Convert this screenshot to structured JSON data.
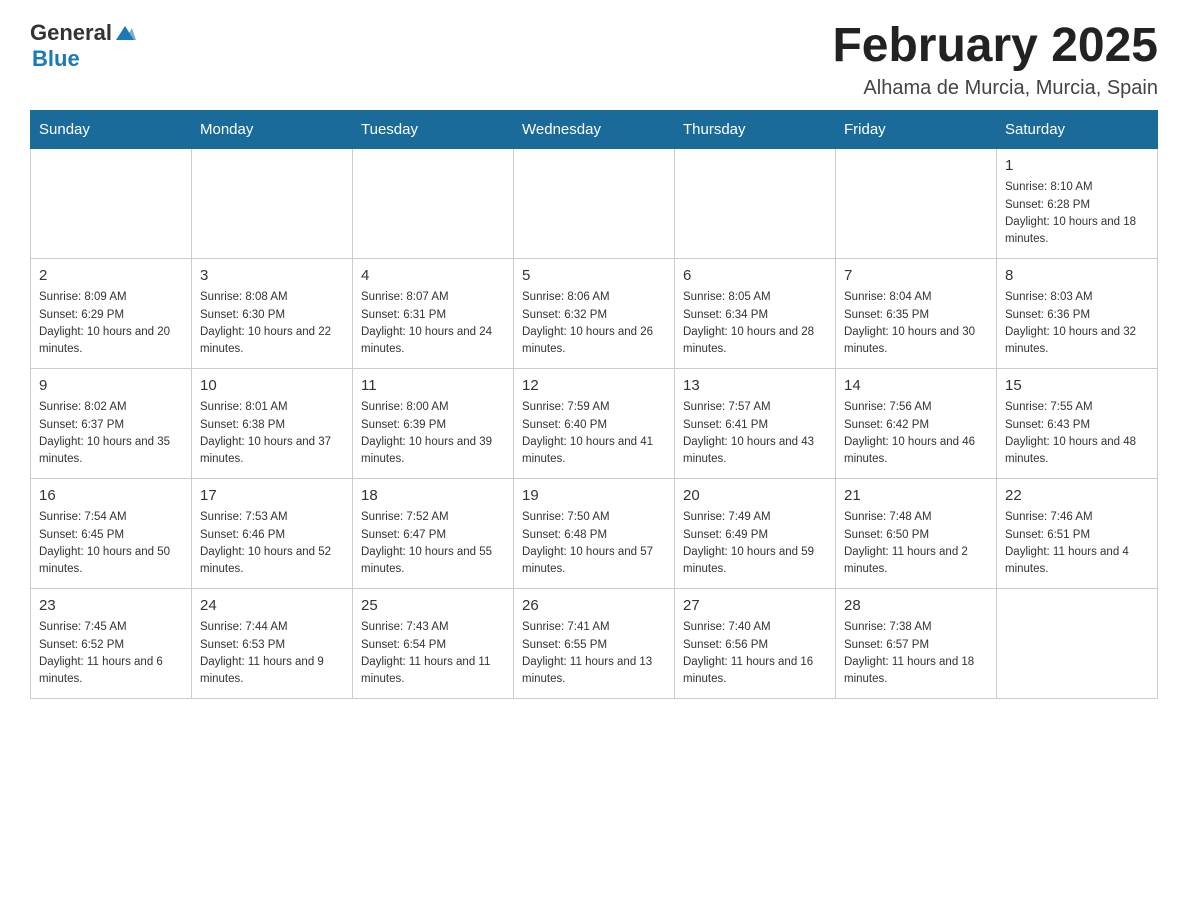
{
  "header": {
    "logo_general": "General",
    "logo_blue": "Blue",
    "month_title": "February 2025",
    "location": "Alhama de Murcia, Murcia, Spain"
  },
  "days_of_week": [
    "Sunday",
    "Monday",
    "Tuesday",
    "Wednesday",
    "Thursday",
    "Friday",
    "Saturday"
  ],
  "weeks": [
    {
      "days": [
        {
          "date": "",
          "info": ""
        },
        {
          "date": "",
          "info": ""
        },
        {
          "date": "",
          "info": ""
        },
        {
          "date": "",
          "info": ""
        },
        {
          "date": "",
          "info": ""
        },
        {
          "date": "",
          "info": ""
        },
        {
          "date": "1",
          "info": "Sunrise: 8:10 AM\nSunset: 6:28 PM\nDaylight: 10 hours and 18 minutes."
        }
      ]
    },
    {
      "days": [
        {
          "date": "2",
          "info": "Sunrise: 8:09 AM\nSunset: 6:29 PM\nDaylight: 10 hours and 20 minutes."
        },
        {
          "date": "3",
          "info": "Sunrise: 8:08 AM\nSunset: 6:30 PM\nDaylight: 10 hours and 22 minutes."
        },
        {
          "date": "4",
          "info": "Sunrise: 8:07 AM\nSunset: 6:31 PM\nDaylight: 10 hours and 24 minutes."
        },
        {
          "date": "5",
          "info": "Sunrise: 8:06 AM\nSunset: 6:32 PM\nDaylight: 10 hours and 26 minutes."
        },
        {
          "date": "6",
          "info": "Sunrise: 8:05 AM\nSunset: 6:34 PM\nDaylight: 10 hours and 28 minutes."
        },
        {
          "date": "7",
          "info": "Sunrise: 8:04 AM\nSunset: 6:35 PM\nDaylight: 10 hours and 30 minutes."
        },
        {
          "date": "8",
          "info": "Sunrise: 8:03 AM\nSunset: 6:36 PM\nDaylight: 10 hours and 32 minutes."
        }
      ]
    },
    {
      "days": [
        {
          "date": "9",
          "info": "Sunrise: 8:02 AM\nSunset: 6:37 PM\nDaylight: 10 hours and 35 minutes."
        },
        {
          "date": "10",
          "info": "Sunrise: 8:01 AM\nSunset: 6:38 PM\nDaylight: 10 hours and 37 minutes."
        },
        {
          "date": "11",
          "info": "Sunrise: 8:00 AM\nSunset: 6:39 PM\nDaylight: 10 hours and 39 minutes."
        },
        {
          "date": "12",
          "info": "Sunrise: 7:59 AM\nSunset: 6:40 PM\nDaylight: 10 hours and 41 minutes."
        },
        {
          "date": "13",
          "info": "Sunrise: 7:57 AM\nSunset: 6:41 PM\nDaylight: 10 hours and 43 minutes."
        },
        {
          "date": "14",
          "info": "Sunrise: 7:56 AM\nSunset: 6:42 PM\nDaylight: 10 hours and 46 minutes."
        },
        {
          "date": "15",
          "info": "Sunrise: 7:55 AM\nSunset: 6:43 PM\nDaylight: 10 hours and 48 minutes."
        }
      ]
    },
    {
      "days": [
        {
          "date": "16",
          "info": "Sunrise: 7:54 AM\nSunset: 6:45 PM\nDaylight: 10 hours and 50 minutes."
        },
        {
          "date": "17",
          "info": "Sunrise: 7:53 AM\nSunset: 6:46 PM\nDaylight: 10 hours and 52 minutes."
        },
        {
          "date": "18",
          "info": "Sunrise: 7:52 AM\nSunset: 6:47 PM\nDaylight: 10 hours and 55 minutes."
        },
        {
          "date": "19",
          "info": "Sunrise: 7:50 AM\nSunset: 6:48 PM\nDaylight: 10 hours and 57 minutes."
        },
        {
          "date": "20",
          "info": "Sunrise: 7:49 AM\nSunset: 6:49 PM\nDaylight: 10 hours and 59 minutes."
        },
        {
          "date": "21",
          "info": "Sunrise: 7:48 AM\nSunset: 6:50 PM\nDaylight: 11 hours and 2 minutes."
        },
        {
          "date": "22",
          "info": "Sunrise: 7:46 AM\nSunset: 6:51 PM\nDaylight: 11 hours and 4 minutes."
        }
      ]
    },
    {
      "days": [
        {
          "date": "23",
          "info": "Sunrise: 7:45 AM\nSunset: 6:52 PM\nDaylight: 11 hours and 6 minutes."
        },
        {
          "date": "24",
          "info": "Sunrise: 7:44 AM\nSunset: 6:53 PM\nDaylight: 11 hours and 9 minutes."
        },
        {
          "date": "25",
          "info": "Sunrise: 7:43 AM\nSunset: 6:54 PM\nDaylight: 11 hours and 11 minutes."
        },
        {
          "date": "26",
          "info": "Sunrise: 7:41 AM\nSunset: 6:55 PM\nDaylight: 11 hours and 13 minutes."
        },
        {
          "date": "27",
          "info": "Sunrise: 7:40 AM\nSunset: 6:56 PM\nDaylight: 11 hours and 16 minutes."
        },
        {
          "date": "28",
          "info": "Sunrise: 7:38 AM\nSunset: 6:57 PM\nDaylight: 11 hours and 18 minutes."
        },
        {
          "date": "",
          "info": ""
        }
      ]
    }
  ]
}
